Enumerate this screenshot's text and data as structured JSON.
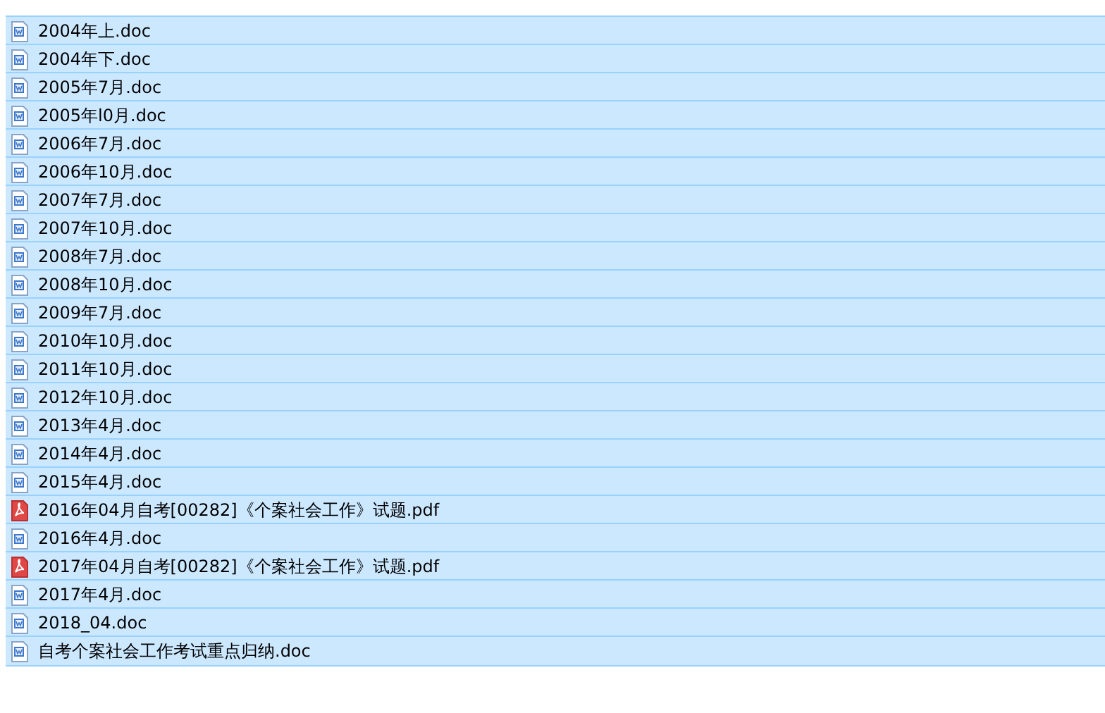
{
  "files": [
    {
      "name": "2004年上.doc",
      "kind": "doc",
      "selected": true
    },
    {
      "name": "2004年下.doc",
      "kind": "doc",
      "selected": true
    },
    {
      "name": "2005年7月.doc",
      "kind": "doc",
      "selected": true
    },
    {
      "name": "2005年l0月.doc",
      "kind": "doc",
      "selected": true
    },
    {
      "name": "2006年7月.doc",
      "kind": "doc",
      "selected": true
    },
    {
      "name": "2006年10月.doc",
      "kind": "doc",
      "selected": true
    },
    {
      "name": "2007年7月.doc",
      "kind": "doc",
      "selected": true
    },
    {
      "name": "2007年10月.doc",
      "kind": "doc",
      "selected": true
    },
    {
      "name": "2008年7月.doc",
      "kind": "doc",
      "selected": true
    },
    {
      "name": "2008年10月.doc",
      "kind": "doc",
      "selected": true
    },
    {
      "name": "2009年7月.doc",
      "kind": "doc",
      "selected": true
    },
    {
      "name": "2010年10月.doc",
      "kind": "doc",
      "selected": true
    },
    {
      "name": "2011年10月.doc",
      "kind": "doc",
      "selected": true
    },
    {
      "name": "2012年10月.doc",
      "kind": "doc",
      "selected": true
    },
    {
      "name": "2013年4月.doc",
      "kind": "doc",
      "selected": true
    },
    {
      "name": "2014年4月.doc",
      "kind": "doc",
      "selected": true
    },
    {
      "name": "2015年4月.doc",
      "kind": "doc",
      "selected": true
    },
    {
      "name": "2016年04月自考[00282]《个案社会工作》试题.pdf",
      "kind": "pdf",
      "selected": true
    },
    {
      "name": "2016年4月.doc",
      "kind": "doc",
      "selected": true
    },
    {
      "name": "2017年04月自考[00282]《个案社会工作》试题.pdf",
      "kind": "pdf",
      "selected": true
    },
    {
      "name": "2017年4月.doc",
      "kind": "doc",
      "selected": true
    },
    {
      "name": "2018_04.doc",
      "kind": "doc",
      "selected": true
    },
    {
      "name": "自考个案社会工作考试重点归纳.doc",
      "kind": "doc",
      "selected": true
    }
  ]
}
